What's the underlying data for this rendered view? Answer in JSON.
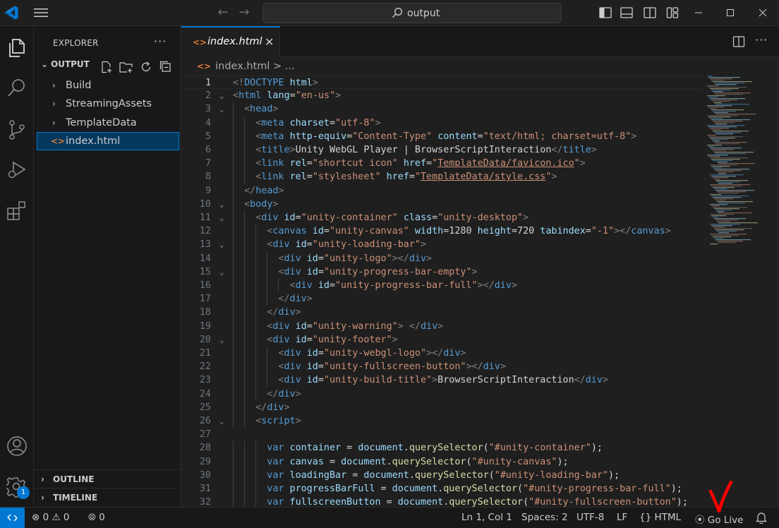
{
  "titlebar": {
    "search_text": "output",
    "accent": "#0078d4"
  },
  "activitybar": {
    "items": [
      "explorer-icon",
      "search-icon",
      "source-control-icon",
      "run-debug-icon",
      "extensions-icon"
    ],
    "bottom": [
      "account-icon",
      "settings-gear-icon"
    ],
    "settings_badge": "1"
  },
  "sidebar": {
    "title": "EXPLORER",
    "more": "···",
    "section": "OUTPUT",
    "tree": [
      {
        "label": "Build",
        "type": "folder"
      },
      {
        "label": "StreamingAssets",
        "type": "folder"
      },
      {
        "label": "TemplateData",
        "type": "folder"
      },
      {
        "label": "index.html",
        "type": "file",
        "selected": true
      }
    ],
    "outline": "OUTLINE",
    "timeline": "TIMELINE"
  },
  "editor": {
    "tab": {
      "label": "index.html",
      "icon": "<>",
      "close": "✕"
    },
    "breadcrumb": {
      "file": "index.html",
      "rest": " > ..."
    },
    "lines": [
      {
        "n": "1",
        "indent": 0,
        "fold": false,
        "html": "<span class='p'>&lt;!</span><span class='t'>DOCTYPE</span> <span class='a'>html</span><span class='p'>&gt;</span>"
      },
      {
        "n": "2",
        "indent": 0,
        "fold": true,
        "html": "<span class='p'>&lt;</span><span class='t'>html</span> <span class='a'>lang</span><span class='x'>=</span><span class='s'>\"en-us\"</span><span class='p'>&gt;</span>"
      },
      {
        "n": "3",
        "indent": 1,
        "fold": true,
        "html": "<span class='p'>&lt;</span><span class='t'>head</span><span class='p'>&gt;</span>"
      },
      {
        "n": "4",
        "indent": 2,
        "fold": false,
        "html": "<span class='p'>&lt;</span><span class='t'>meta</span> <span class='a'>charset</span><span class='x'>=</span><span class='s'>\"utf-8\"</span><span class='p'>&gt;</span>"
      },
      {
        "n": "5",
        "indent": 2,
        "fold": false,
        "html": "<span class='p'>&lt;</span><span class='t'>meta</span> <span class='a'>http-equiv</span><span class='x'>=</span><span class='s'>\"Content-Type\"</span> <span class='a'>content</span><span class='x'>=</span><span class='s'>\"text/html; charset=utf-8\"</span><span class='p'>&gt;</span>"
      },
      {
        "n": "6",
        "indent": 2,
        "fold": false,
        "html": "<span class='p'>&lt;</span><span class='t'>title</span><span class='p'>&gt;</span><span class='x'>Unity WebGL Player | BrowserScriptInteraction</span><span class='p'>&lt;/</span><span class='t'>title</span><span class='p'>&gt;</span>"
      },
      {
        "n": "7",
        "indent": 2,
        "fold": false,
        "html": "<span class='p'>&lt;</span><span class='t'>link</span> <span class='a'>rel</span><span class='x'>=</span><span class='s'>\"shortcut icon\"</span> <span class='a'>href</span><span class='x'>=</span><span class='s'>\"<span class='u'>TemplateData/favicon.ico</span>\"</span><span class='p'>&gt;</span>"
      },
      {
        "n": "8",
        "indent": 2,
        "fold": false,
        "html": "<span class='p'>&lt;</span><span class='t'>link</span> <span class='a'>rel</span><span class='x'>=</span><span class='s'>\"stylesheet\"</span> <span class='a'>href</span><span class='x'>=</span><span class='s'>\"<span class='u'>TemplateData/style.css</span>\"</span><span class='p'>&gt;</span>"
      },
      {
        "n": "9",
        "indent": 1,
        "fold": false,
        "html": "<span class='p'>&lt;/</span><span class='t'>head</span><span class='p'>&gt;</span>"
      },
      {
        "n": "10",
        "indent": 1,
        "fold": true,
        "html": "<span class='p'>&lt;</span><span class='t'>body</span><span class='p'>&gt;</span>"
      },
      {
        "n": "11",
        "indent": 2,
        "fold": true,
        "html": "<span class='p'>&lt;</span><span class='t'>div</span> <span class='a'>id</span><span class='x'>=</span><span class='s'>\"unity-container\"</span> <span class='a'>class</span><span class='x'>=</span><span class='s'>\"unity-desktop\"</span><span class='p'>&gt;</span>"
      },
      {
        "n": "12",
        "indent": 3,
        "fold": false,
        "html": "<span class='p'>&lt;</span><span class='t'>canvas</span> <span class='a'>id</span><span class='x'>=</span><span class='s'>\"unity-canvas\"</span> <span class='a'>width</span><span class='x'>=1280</span> <span class='a'>height</span><span class='x'>=720</span> <span class='a'>tabindex</span><span class='x'>=</span><span class='s'>\"-1\"</span><span class='p'>&gt;&lt;/</span><span class='t'>canvas</span><span class='p'>&gt;</span>"
      },
      {
        "n": "13",
        "indent": 3,
        "fold": true,
        "html": "<span class='p'>&lt;</span><span class='t'>div</span> <span class='a'>id</span><span class='x'>=</span><span class='s'>\"unity-loading-bar\"</span><span class='p'>&gt;</span>"
      },
      {
        "n": "14",
        "indent": 4,
        "fold": false,
        "html": "<span class='p'>&lt;</span><span class='t'>div</span> <span class='a'>id</span><span class='x'>=</span><span class='s'>\"unity-logo\"</span><span class='p'>&gt;&lt;/</span><span class='t'>div</span><span class='p'>&gt;</span>"
      },
      {
        "n": "15",
        "indent": 4,
        "fold": true,
        "html": "<span class='p'>&lt;</span><span class='t'>div</span> <span class='a'>id</span><span class='x'>=</span><span class='s'>\"unity-progress-bar-empty\"</span><span class='p'>&gt;</span>"
      },
      {
        "n": "16",
        "indent": 5,
        "fold": false,
        "html": "<span class='p'>&lt;</span><span class='t'>div</span> <span class='a'>id</span><span class='x'>=</span><span class='s'>\"unity-progress-bar-full\"</span><span class='p'>&gt;&lt;/</span><span class='t'>div</span><span class='p'>&gt;</span>"
      },
      {
        "n": "17",
        "indent": 4,
        "fold": false,
        "html": "<span class='p'>&lt;/</span><span class='t'>div</span><span class='p'>&gt;</span>"
      },
      {
        "n": "18",
        "indent": 3,
        "fold": false,
        "html": "<span class='p'>&lt;/</span><span class='t'>div</span><span class='p'>&gt;</span>"
      },
      {
        "n": "19",
        "indent": 3,
        "fold": false,
        "html": "<span class='p'>&lt;</span><span class='t'>div</span> <span class='a'>id</span><span class='x'>=</span><span class='s'>\"unity-warning\"</span><span class='p'>&gt;</span> <span class='p'>&lt;/</span><span class='t'>div</span><span class='p'>&gt;</span>"
      },
      {
        "n": "20",
        "indent": 3,
        "fold": true,
        "html": "<span class='p'>&lt;</span><span class='t'>div</span> <span class='a'>id</span><span class='x'>=</span><span class='s'>\"unity-footer\"</span><span class='p'>&gt;</span>"
      },
      {
        "n": "21",
        "indent": 4,
        "fold": false,
        "html": "<span class='p'>&lt;</span><span class='t'>div</span> <span class='a'>id</span><span class='x'>=</span><span class='s'>\"unity-webgl-logo\"</span><span class='p'>&gt;&lt;/</span><span class='t'>div</span><span class='p'>&gt;</span>"
      },
      {
        "n": "22",
        "indent": 4,
        "fold": false,
        "html": "<span class='p'>&lt;</span><span class='t'>div</span> <span class='a'>id</span><span class='x'>=</span><span class='s'>\"unity-fullscreen-button\"</span><span class='p'>&gt;&lt;/</span><span class='t'>div</span><span class='p'>&gt;</span>"
      },
      {
        "n": "23",
        "indent": 4,
        "fold": false,
        "html": "<span class='p'>&lt;</span><span class='t'>div</span> <span class='a'>id</span><span class='x'>=</span><span class='s'>\"unity-build-title\"</span><span class='p'>&gt;</span><span class='x'>BrowserScriptInteraction</span><span class='p'>&lt;/</span><span class='t'>div</span><span class='p'>&gt;</span>"
      },
      {
        "n": "24",
        "indent": 3,
        "fold": false,
        "html": "<span class='p'>&lt;/</span><span class='t'>div</span><span class='p'>&gt;</span>"
      },
      {
        "n": "25",
        "indent": 2,
        "fold": false,
        "html": "<span class='p'>&lt;/</span><span class='t'>div</span><span class='p'>&gt;</span>"
      },
      {
        "n": "26",
        "indent": 2,
        "fold": true,
        "html": "<span class='p'>&lt;</span><span class='t'>script</span><span class='p'>&gt;</span>"
      },
      {
        "n": "27",
        "indent": 0,
        "fold": false,
        "html": ""
      },
      {
        "n": "28",
        "indent": 3,
        "fold": false,
        "html": "<span class='k'>var</span> <span class='v'>container</span> <span class='x'>=</span> <span class='v'>document</span><span class='x'>.</span><span class='f'>querySelector</span><span class='x'>(</span><span class='s'>\"#unity-container\"</span><span class='x'>);</span>"
      },
      {
        "n": "29",
        "indent": 3,
        "fold": false,
        "html": "<span class='k'>var</span> <span class='v'>canvas</span> <span class='x'>=</span> <span class='v'>document</span><span class='x'>.</span><span class='f'>querySelector</span><span class='x'>(</span><span class='s'>\"#unity-canvas\"</span><span class='x'>);</span>"
      },
      {
        "n": "30",
        "indent": 3,
        "fold": false,
        "html": "<span class='k'>var</span> <span class='v'>loadingBar</span> <span class='x'>=</span> <span class='v'>document</span><span class='x'>.</span><span class='f'>querySelector</span><span class='x'>(</span><span class='s'>\"#unity-loading-bar\"</span><span class='x'>);</span>"
      },
      {
        "n": "31",
        "indent": 3,
        "fold": false,
        "html": "<span class='k'>var</span> <span class='v'>progressBarFull</span> <span class='x'>=</span> <span class='v'>document</span><span class='x'>.</span><span class='f'>querySelector</span><span class='x'>(</span><span class='s'>\"#unity-progress-bar-full\"</span><span class='x'>);</span>"
      },
      {
        "n": "32",
        "indent": 3,
        "fold": false,
        "html": "<span class='k'>var</span> <span class='v'>fullscreenButton</span> <span class='x'>=</span> <span class='v'>document</span><span class='x'>.</span><span class='f'>querySelector</span><span class='x'>(</span><span class='s'>\"#unity-fullscreen-button\"</span><span class='x'>);</span>"
      }
    ]
  },
  "statusbar": {
    "errors": "0",
    "warnings": "0",
    "ports": "0",
    "position": "Ln 1, Col 1",
    "spaces": "Spaces: 2",
    "encoding": "UTF-8",
    "eol": "LF",
    "language": "HTML",
    "go_live": "Go Live"
  },
  "colors": {
    "accent": "#0078d4",
    "html_icon": "#e37933",
    "annotation_check": "#ff0000"
  }
}
